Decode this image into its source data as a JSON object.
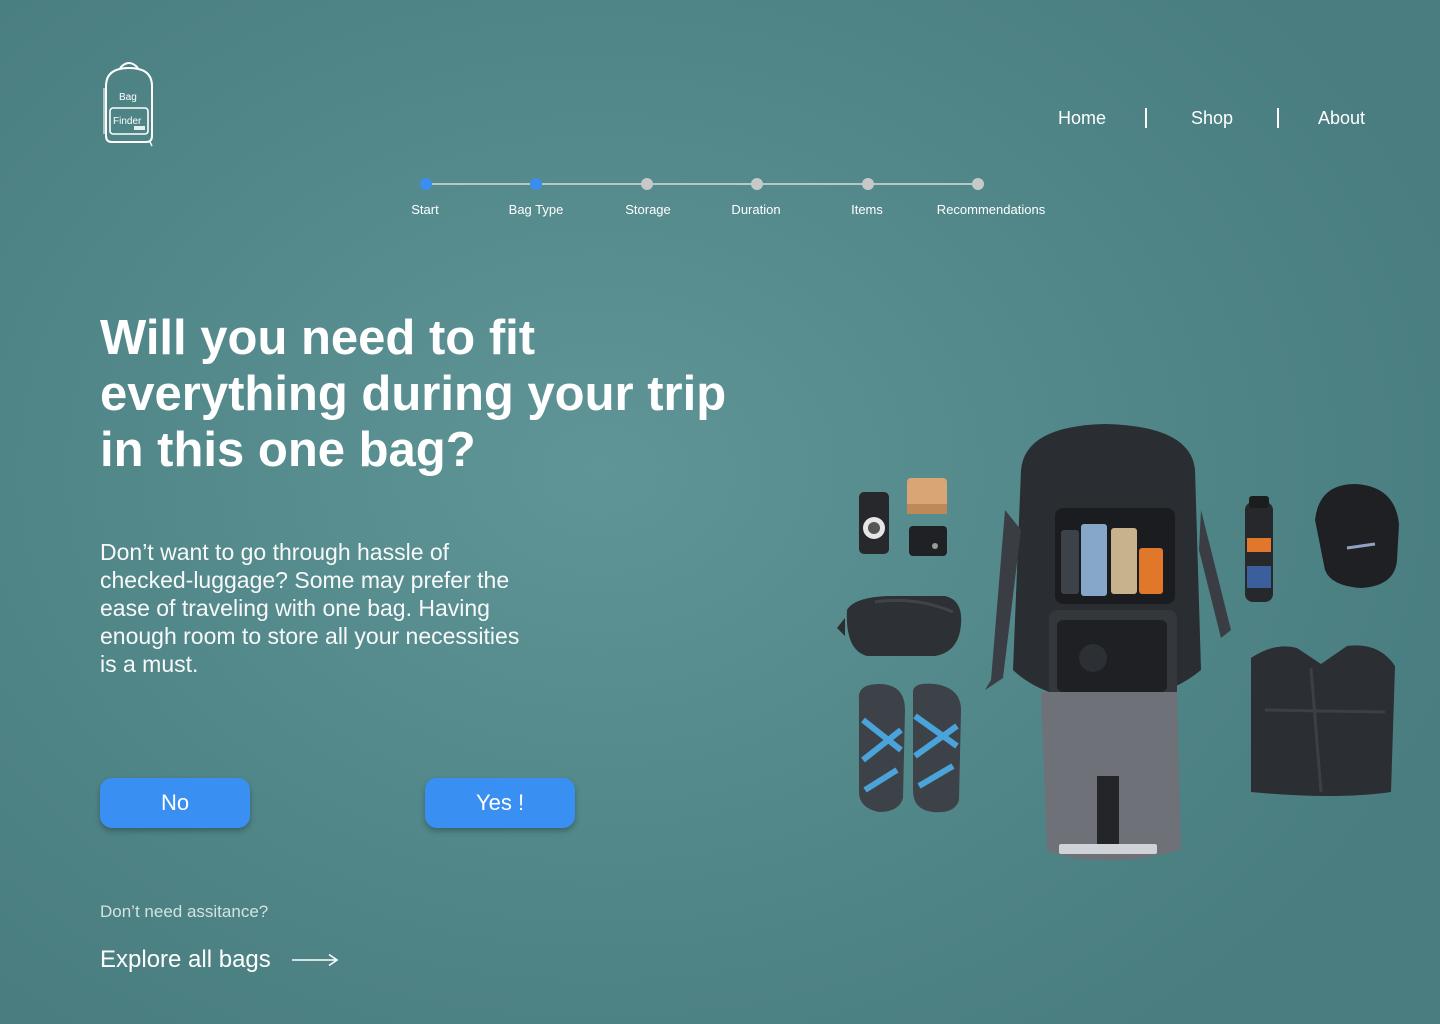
{
  "logo": {
    "line1": "Bag",
    "line2": "Finder",
    "icon": "backpack-logo-icon"
  },
  "nav": {
    "items": [
      {
        "label": "Home"
      },
      {
        "label": "Shop"
      },
      {
        "label": "About"
      }
    ]
  },
  "stepper": {
    "steps": [
      {
        "label": "Start",
        "active": true
      },
      {
        "label": "Bag Type",
        "active": true
      },
      {
        "label": "Storage",
        "active": false
      },
      {
        "label": "Duration",
        "active": false
      },
      {
        "label": "Items",
        "active": false
      },
      {
        "label": "Recommendations",
        "active": false
      }
    ],
    "active_color": "#3b8ef0",
    "inactive_color": "#c7c9c9"
  },
  "main": {
    "question": "Will you need to fit everything during your trip in this one bag?",
    "description": "Don’t want to go through hassle of checked-luggage? Some may prefer the ease of traveling with one bag. Having enough room to store all your necessities is a must.",
    "buttons": {
      "no": "No",
      "yes": "Yes !"
    },
    "button_color": "#3a8ff2"
  },
  "footer": {
    "hint": "Don’t need assitance?",
    "explore_label": "Explore all bags",
    "explore_icon": "long-arrow-right-icon"
  },
  "illustration": {
    "items": [
      "phone-icon",
      "wallet-icon",
      "camera-pouch-icon",
      "sling-bag-icon",
      "sandals-icon",
      "open-backpack-icon",
      "water-bottle-icon",
      "cap-icon",
      "jacket-icon"
    ]
  },
  "colors": {
    "background": "#548a8c",
    "text": "#ffffff"
  }
}
